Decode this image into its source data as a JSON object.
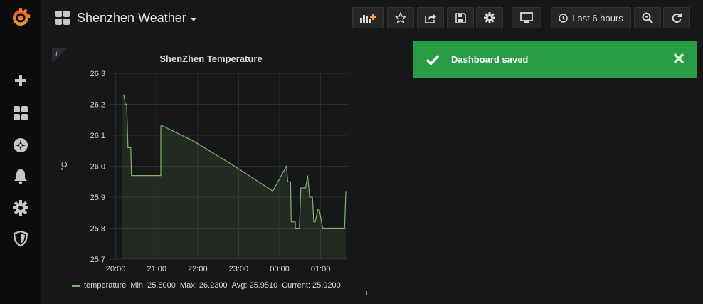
{
  "sidebar": {
    "items": [
      {
        "icon": "grafana-logo-icon",
        "label": ""
      },
      {
        "icon": "plus-icon",
        "label": ""
      },
      {
        "icon": "dashboards-icon",
        "label": ""
      },
      {
        "icon": "explore-compass-icon",
        "label": ""
      },
      {
        "icon": "bell-icon",
        "label": ""
      },
      {
        "icon": "gear-icon",
        "label": ""
      },
      {
        "icon": "shield-icon",
        "label": ""
      }
    ]
  },
  "header": {
    "dashboard_title": "Shenzhen Weather",
    "time_range_label": "Last 6 hours",
    "buttons": [
      "add-panel-icon",
      "star-icon",
      "share-icon",
      "save-icon",
      "gear-icon",
      "monitor-icon",
      "clock-icon",
      "zoom-out-icon",
      "refresh-icon"
    ]
  },
  "toast": {
    "message": "Dashboard saved",
    "color": "#299c46"
  },
  "panel": {
    "title": "ShenZhen Temperature",
    "info_glyph": "i",
    "legend": {
      "series_name": "temperature",
      "min": "Min: 25.8000",
      "max": "Max: 26.2300",
      "avg": "Avg: 25.9510",
      "current": "Current: 25.9200",
      "color": "#7eb26d"
    }
  },
  "chart_data": {
    "type": "area",
    "title": "ShenZhen Temperature",
    "xlabel": "",
    "ylabel": "°C",
    "ylim": [
      25.7,
      26.3
    ],
    "yticks": [
      "25.7",
      "25.8",
      "25.9",
      "26.0",
      "26.1",
      "26.2",
      "26.3"
    ],
    "xticks": [
      "20:00",
      "21:00",
      "22:00",
      "23:00",
      "00:00",
      "01:00"
    ],
    "xlim": [
      "19:51",
      "01:40"
    ],
    "grid": true,
    "series": [
      {
        "name": "temperature",
        "color": "#7eb26d",
        "x": [
          "20:10",
          "20:12",
          "20:14",
          "20:16",
          "20:18",
          "20:22",
          "20:23",
          "21:06",
          "21:06",
          "21:09",
          "21:55",
          "21:55",
          "22:54",
          "22:54",
          "23:50",
          "23:50",
          "00:10",
          "00:10",
          "00:12",
          "00:16",
          "00:17",
          "00:23",
          "00:23",
          "00:29",
          "00:31",
          "00:38",
          "00:41",
          "00:44",
          "00:48",
          "00:50",
          "00:52",
          "00:56",
          "00:58",
          "01:03",
          "01:07",
          "01:35",
          "01:37"
        ],
        "y": [
          26.23,
          26.23,
          26.2,
          26.2,
          26.06,
          26.06,
          25.97,
          25.97,
          26.13,
          26.13,
          26.08,
          26.08,
          26.0,
          26.0,
          25.92,
          25.92,
          26.0,
          26.0,
          25.95,
          25.95,
          25.82,
          25.82,
          25.8,
          25.8,
          25.93,
          25.93,
          25.97,
          25.9,
          25.9,
          25.82,
          25.82,
          25.86,
          25.86,
          25.8,
          25.8,
          25.8,
          25.92
        ]
      }
    ]
  }
}
